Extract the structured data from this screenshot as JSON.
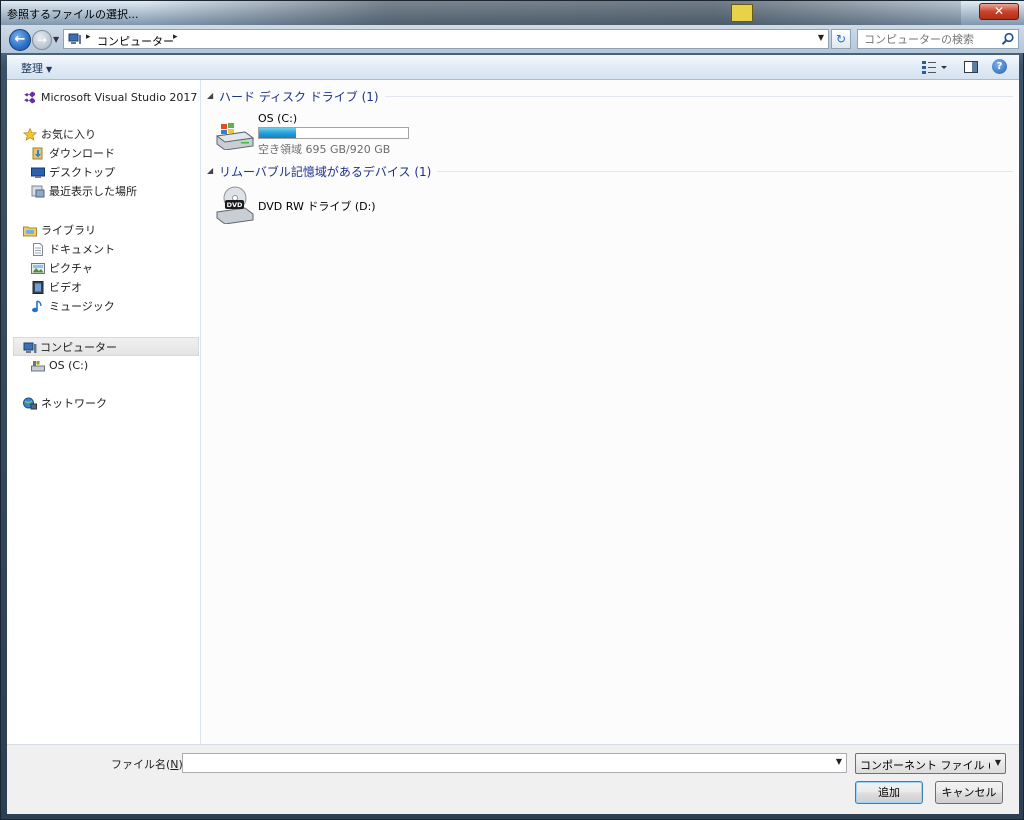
{
  "window": {
    "title": "参照するファイルの選択...",
    "close_label": "✕"
  },
  "address": {
    "crumb": "コンピューター",
    "search_placeholder": "コンピューターの検索"
  },
  "toolbar": {
    "organize_label": "整理",
    "help_label": "?"
  },
  "sidebar": {
    "items": [
      {
        "label": "Microsoft Visual Studio 2017",
        "icon": "visual-studio-icon"
      },
      {
        "label": "お気に入り",
        "icon": "star-icon"
      },
      {
        "label": "ダウンロード",
        "icon": "downloads-icon"
      },
      {
        "label": "デスクトップ",
        "icon": "desktop-icon"
      },
      {
        "label": "最近表示した場所",
        "icon": "recent-places-icon"
      },
      {
        "label": "ライブラリ",
        "icon": "libraries-icon"
      },
      {
        "label": "ドキュメント",
        "icon": "documents-icon"
      },
      {
        "label": "ピクチャ",
        "icon": "pictures-icon"
      },
      {
        "label": "ビデオ",
        "icon": "videos-icon"
      },
      {
        "label": "ミュージック",
        "icon": "music-icon"
      },
      {
        "label": "コンピューター",
        "icon": "computer-icon"
      },
      {
        "label": "OS (C:)",
        "icon": "hard-drive-icon"
      },
      {
        "label": "ネットワーク",
        "icon": "network-icon"
      }
    ]
  },
  "content": {
    "groups": [
      {
        "header": "ハード ディスク ドライブ (1)"
      },
      {
        "header": "リムーバブル記憶域があるデバイス (1)"
      }
    ],
    "drive_c": {
      "name": "OS (C:)",
      "free_text": "空き領域 695 GB/920 GB",
      "used_fraction": 0.245
    },
    "drive_d": {
      "name": "DVD RW ドライブ (D:)",
      "badge": "DVD"
    }
  },
  "bottom": {
    "filename_label": "ファイル名",
    "filename_mnemonic": "N",
    "filename_value": "",
    "filter_value": "コンポーネント ファイル (*.d",
    "add_label": "追加",
    "cancel_label": "キャンセル"
  },
  "colors": {
    "group_header": "#1e3287",
    "progress_fill": "#26a0da",
    "link_blue": "#1e395b"
  }
}
